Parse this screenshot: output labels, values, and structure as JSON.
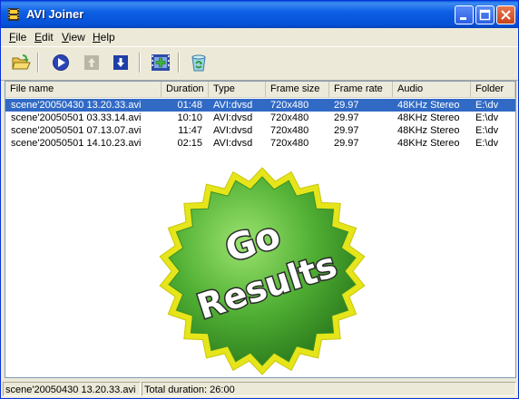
{
  "window": {
    "title": "AVI Joiner"
  },
  "menu": {
    "items": [
      {
        "label": "File",
        "key": "F",
        "rest": "ile"
      },
      {
        "label": "Edit",
        "key": "E",
        "rest": "dit"
      },
      {
        "label": "View",
        "key": "V",
        "rest": "iew"
      },
      {
        "label": "Help",
        "key": "H",
        "rest": "elp"
      }
    ]
  },
  "toolbar": {
    "buttons": [
      "open-folder-icon",
      "play-icon",
      "move-up-icon",
      "move-down-icon",
      "add-film-icon",
      "recycle-bin-icon"
    ]
  },
  "list": {
    "columns": [
      "File name",
      "Duration",
      "Type",
      "Frame size",
      "Frame rate",
      "Audio",
      "Folder"
    ],
    "rows": [
      {
        "file": "scene'20050430 13.20.33.avi",
        "duration": "01:48",
        "type": "AVI:dvsd",
        "size": "720x480",
        "rate": "29.97",
        "audio": "48KHz Stereo",
        "folder": "E:\\dv",
        "selected": true
      },
      {
        "file": "scene'20050501 03.33.14.avi",
        "duration": "10:10",
        "type": "AVI:dvsd",
        "size": "720x480",
        "rate": "29.97",
        "audio": "48KHz Stereo",
        "folder": "E:\\dv",
        "selected": false
      },
      {
        "file": "scene'20050501 07.13.07.avi",
        "duration": "11:47",
        "type": "AVI:dvsd",
        "size": "720x480",
        "rate": "29.97",
        "audio": "48KHz Stereo",
        "folder": "E:\\dv",
        "selected": false
      },
      {
        "file": "scene'20050501 14.10.23.avi",
        "duration": "02:15",
        "type": "AVI:dvsd",
        "size": "720x480",
        "rate": "29.97",
        "audio": "48KHz Stereo",
        "folder": "E:\\dv",
        "selected": false
      }
    ]
  },
  "badge": {
    "line1": "Go",
    "line2": "Results"
  },
  "status": {
    "file": "scene'20050430 13.20.33.avi",
    "total": "Total duration: 26:00"
  },
  "colors": {
    "titlebar": "#0550d6",
    "selection": "#316ac5",
    "badge_green": "#3d9b2f",
    "badge_outline": "#e5e51a"
  }
}
